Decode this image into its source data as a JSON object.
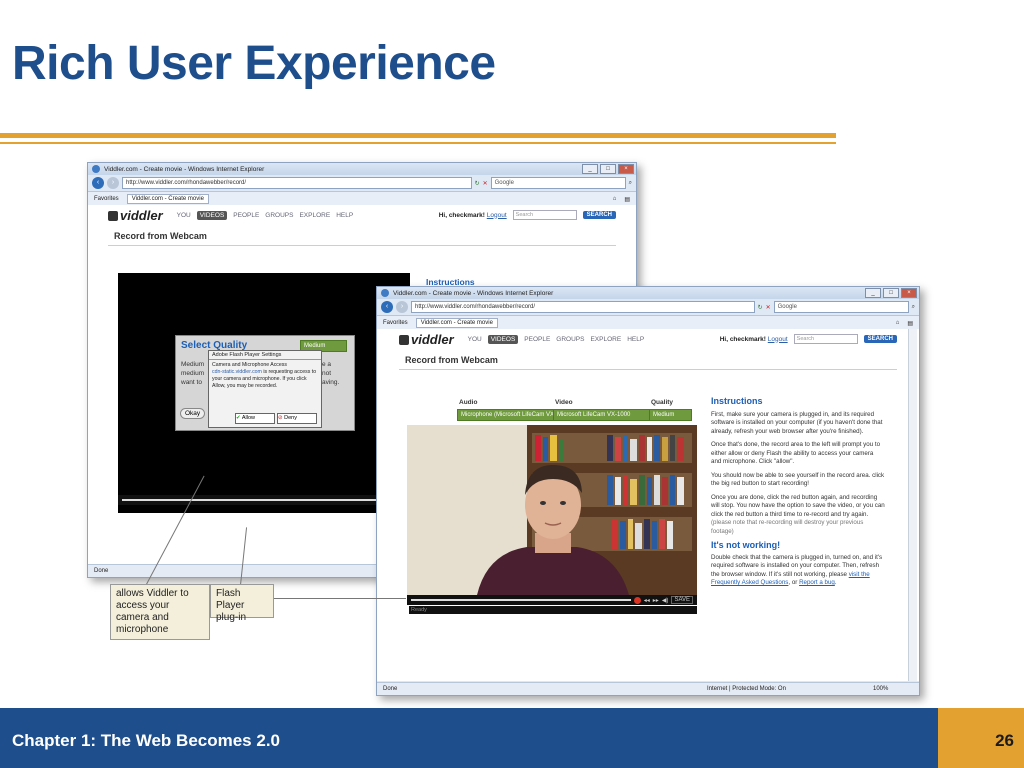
{
  "slide": {
    "title": "Rich User Experience",
    "footer_text": "Chapter 1: The Web Becomes 2.0",
    "page_number": "26"
  },
  "browser_back": {
    "title": "Viddler.com - Create movie - Windows Internet Explorer",
    "url": "http://www.viddler.com/rhondawebber/record/",
    "search_provider": "Google",
    "favorites": "Favorites",
    "tab": "Viddler.com - Create movie",
    "status": "Done"
  },
  "browser_front": {
    "title": "Viddler.com - Create movie - Windows Internet Explorer",
    "url": "http://www.viddler.com/rhondawebber/record/",
    "search_provider": "Google",
    "favorites": "Favorites",
    "tab": "Viddler.com - Create movie",
    "status": "Done",
    "zone": "Internet | Protected Mode: On",
    "zoom": "100%"
  },
  "viddler": {
    "logo": "viddler",
    "nav": [
      "YOU",
      "VIDEOS",
      "PEOPLE",
      "GROUPS",
      "EXPLORE",
      "HELP"
    ],
    "greeting": "Hi, checkmark!",
    "logout": "Logout",
    "search_placeholder": "Search",
    "search_button": "SEARCH",
    "page_heading": "Record from Webcam",
    "instructions_heading": "Instructions",
    "not_working_heading": "It's not working!"
  },
  "quality_dialog": {
    "heading": "Select Quality",
    "value": "Medium",
    "body_start": "Medium",
    "body_start2": "medium",
    "body_start3": "want to",
    "body_end1": "e a",
    "body_end2": "not",
    "body_end3": "aving.",
    "okay": "Okay"
  },
  "flash_settings": {
    "title": "Adobe Flash Player Settings",
    "heading": "Camera and Microphone Access",
    "domain": "cdn-static.viddler.com",
    "body": " is requesting access to your camera and microphone. If you click Allow, you may be recorded.",
    "allow": "Allow",
    "deny": "Deny"
  },
  "recorder": {
    "audio_label": "Audio",
    "audio_value": "Microphone (Microsoft LifeCam VX-1000)",
    "video_label": "Video",
    "video_value": "Microsoft LifeCam VX-1000",
    "quality_label": "Quality",
    "quality_value": "Medium",
    "ready": "Ready",
    "save": "SAVE"
  },
  "instructions": {
    "p1": "First, make sure your camera is plugged in, and its required software is installed on your computer (if you haven't done that already, refresh your web browser after you're finished).",
    "p2": "Once that's done, the record area to the left will prompt you to either allow or deny Flash the ability to access your camera and microphone. Click \"allow\".",
    "p3": "You should now be able to see yourself in the record area. click the big red button to start recording!",
    "p4": "Once you are done, click the red button again, and recording will stop. You now have the option to save the video, or you can click the red button a third time to re-record and try again.",
    "p4_note": "(please note that re-recording will destroy your previous footage)",
    "p5": "Double check that the camera is plugged in, turned on, and it's required software is installed on your computer. Then, refresh the browser window. If it's still not working, please ",
    "p5_link1": "visit the Frequently Asked Questions",
    "p5_mid": ", or ",
    "p5_link2": "Report a bug",
    "p5_end": "."
  },
  "callouts": {
    "viddler_access": "allows Viddler to access your camera and microphone",
    "flash_plugin": "Flash Player plug-in"
  },
  "colors": {
    "title_blue": "#1f4e8c",
    "gold": "#e3a12f",
    "link_blue": "#1d5fb5",
    "dropdown_green": "#6f9a3e"
  },
  "icons": [
    "ie-icon",
    "back-icon",
    "forward-icon",
    "refresh-icon",
    "stop-icon",
    "search-icon",
    "home-icon",
    "print-icon",
    "record-icon"
  ]
}
